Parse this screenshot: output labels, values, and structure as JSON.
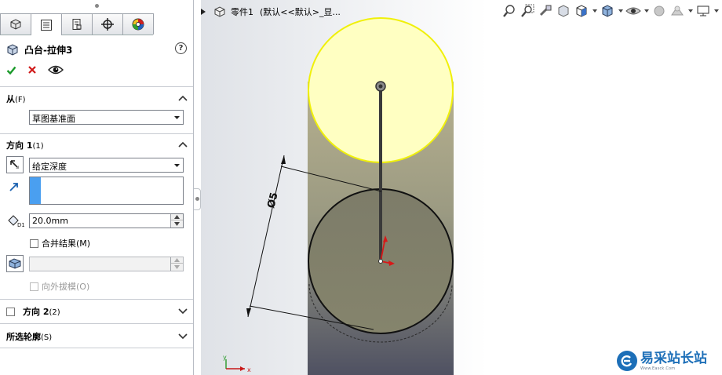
{
  "feature": {
    "title": "凸台-拉伸3",
    "help_label": "?"
  },
  "tabs": [
    {
      "name": "feature-manager-icon",
      "active": false
    },
    {
      "name": "property-manager-icon",
      "active": true
    },
    {
      "name": "configuration-manager-icon",
      "active": false
    },
    {
      "name": "dim-xpert-icon",
      "active": false
    },
    {
      "name": "display-manager-icon",
      "active": false
    }
  ],
  "from": {
    "label": "从",
    "shortcut": "(F)",
    "value": "草图基准面"
  },
  "direction1": {
    "label": "方向 1",
    "shortcut": "(1)",
    "end_condition": "给定深度",
    "depth": "20.0mm",
    "merge_label": "合并结果(M)",
    "draft_label": "向外拔模(O)"
  },
  "direction2": {
    "label": "方向 2",
    "shortcut": "(2)"
  },
  "selected_contours": {
    "label": "所选轮廓",
    "shortcut": "(S)"
  },
  "viewport": {
    "breadcrumb_part": "零件1",
    "breadcrumb_config": "(默认<<默认>_显...",
    "dimension_text": "Ø5",
    "axis_x": "x",
    "axis_y": "y",
    "colors": {
      "top_face": "#ffffc2",
      "top_edge": "#f2f20a",
      "body": "#a7a489",
      "body_lower": "#5a5d6c",
      "origin": "#d81818"
    }
  },
  "watermark": {
    "brand": "易采站长站",
    "subtitle": "Www.Easck.Com"
  }
}
